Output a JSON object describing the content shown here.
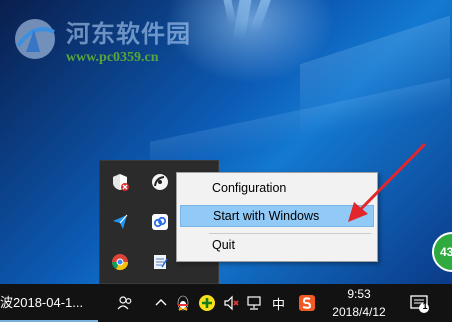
{
  "watermark": {
    "title": "河东软件园",
    "url": "www.pc0359.cn"
  },
  "context_menu": {
    "items": [
      {
        "label": "Configuration",
        "highlighted": false
      },
      {
        "label": "Start with Windows",
        "highlighted": true
      },
      {
        "label": "Quit",
        "highlighted": false
      }
    ]
  },
  "taskbar": {
    "app_label": "波2018-04-1...",
    "ime_label": "中",
    "clock_time": "9:53",
    "clock_date": "2018/4/12",
    "notification_count": "1"
  },
  "badge": {
    "text": "43"
  },
  "colors": {
    "menu_highlight": "#91c9f7",
    "arrow": "#e3262a",
    "taskbar": "#121212",
    "badge_green": "#2eaa3f"
  },
  "icons": {
    "tray_popup": [
      "shield-x-icon",
      "satellite-dish-icon",
      "send-arrow-icon",
      "cloud-drive-icon",
      "chrome-like-icon",
      "notepad-icon"
    ],
    "taskbar": [
      "people-icon",
      "chevron-up-icon",
      "penguin-icon",
      "plus-circle-icon",
      "volume-muted-icon",
      "network-icon",
      "ime-sogou-icon",
      "notification-center-icon"
    ]
  }
}
